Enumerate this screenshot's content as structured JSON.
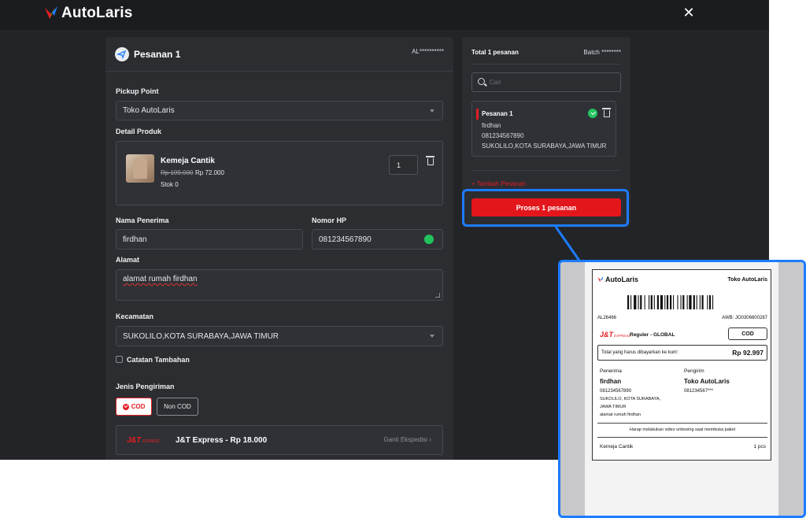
{
  "app": {
    "name": "AutoLaris"
  },
  "form": {
    "order_title": "Pesanan 1",
    "order_code": "AL**********",
    "pickup_label": "Pickup Point",
    "pickup_value": "Toko AutoLaris",
    "product_label": "Detail Produk",
    "product": {
      "name": "Kemeja Cantik",
      "old_price": "Rp 199.000",
      "price": "Rp 72.000",
      "stock": "Stok 0",
      "qty": "1"
    },
    "recipient_label": "Nama Penerima",
    "recipient_value": "firdhan",
    "phone_label": "Nomor HP",
    "phone_value": "081234567890",
    "address_label": "Alamat",
    "address_value": "alamat rumah firdhan",
    "district_label": "Kecamatan",
    "district_value": "SUKOLILO,KOTA SURABAYA,JAWA TIMUR",
    "notes_label": "Catatan Tambahan",
    "shipping_label": "Jenis Pengiriman",
    "shipping_options": [
      "COD",
      "Non COD"
    ],
    "courier_logo": "J&T",
    "courier_logo_sub": "EXPRESS",
    "courier_name": "J&T Express - Rp 18.000",
    "change_courier": "Ganti Ekspedisi"
  },
  "summary": {
    "total": "Total 1 pesanan",
    "batch": "Batch ********",
    "search_placeholder": "Cari",
    "item": {
      "title": "Pesanan 1",
      "name": "firdhan",
      "phone": "081234567890",
      "district": "SUKOLILO,KOTA SURABAYA,JAWA TIMUR"
    },
    "add_order": "+ Tambah Pesanan",
    "process": "Proses 1 pesanan"
  },
  "label": {
    "brand": "AutoLaris",
    "store": "Toko AutoLaris",
    "code": "AL26466",
    "awb": "AWB: JO0306600287",
    "courier": "J&T",
    "courier_sub": "EXPRESS",
    "service": "Reguler - GLOBAL",
    "cod": "COD",
    "pay_label": "Total yang harus dibayarkan ke kurir:",
    "pay_amount": "Rp 92.997",
    "recipient_head": "Penerima",
    "sender_head": "Pengirim",
    "recipient_name": "firdhan",
    "recipient_phone": "081234567890",
    "recipient_addr1": "SUKOLILO, KOTA SURABAYA,",
    "recipient_addr2": "JAWA TIMUR",
    "recipient_addr3": "alamat rumah firdhan",
    "sender_name": "Toko AutoLaris",
    "sender_phone": "081234567***",
    "notice": "Harap melakukan video unboxing saat membuka paket",
    "item_name": "Kemeja Cantik",
    "item_qty": "1 pcs"
  },
  "colors": {
    "accent_red": "#e31e24",
    "highlight_blue": "#1c7cff",
    "success_green": "#22c35e",
    "dark_bg": "#222428",
    "card_bg": "#2b2d31"
  },
  "icons": [
    "logo-icon",
    "close-icon",
    "send-icon",
    "caret-down-icon",
    "trash-icon",
    "whatsapp-icon",
    "check-icon",
    "search-icon",
    "chevron-right-icon",
    "check-circle-icon"
  ]
}
